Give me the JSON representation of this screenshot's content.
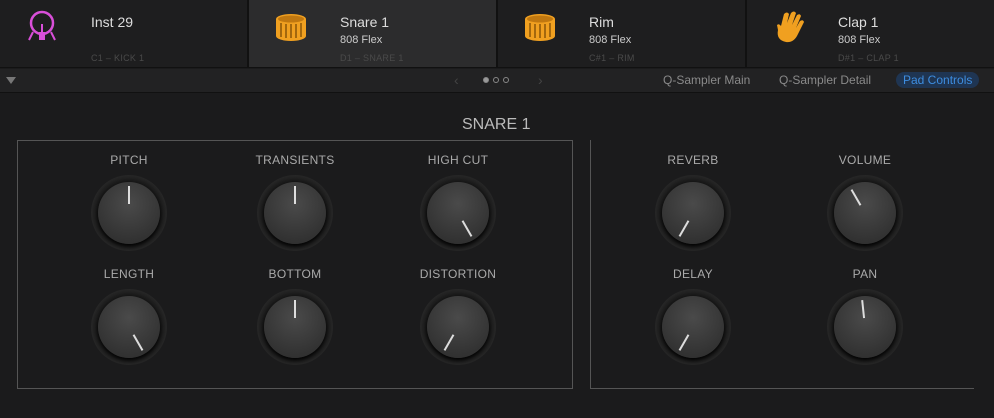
{
  "pads": [
    {
      "name": "Inst 29",
      "sub": "",
      "note": "C1 – KICK 1",
      "icon": "kick-drum-icon",
      "color": "#d94fd9"
    },
    {
      "name": "Snare 1",
      "sub": "808 Flex",
      "note": "D1 – SNARE 1",
      "icon": "snare-drum-icon",
      "color": "#f0a020"
    },
    {
      "name": "Rim",
      "sub": "808 Flex",
      "note": "C#1 – RIM",
      "icon": "snare-drum-icon",
      "color": "#f0a020"
    },
    {
      "name": "Clap 1",
      "sub": "808 Flex",
      "note": "D#1 – CLAP 1",
      "icon": "hand-clap-icon",
      "color": "#f0a020"
    }
  ],
  "nav": {
    "prev": "‹",
    "next": "›",
    "page": 1,
    "pages": 3
  },
  "tabs": [
    "Q-Sampler Main",
    "Q-Sampler Detail",
    "Pad Controls"
  ],
  "active_tab": "Pad Controls",
  "section_title": "SNARE 1",
  "knobs": [
    {
      "label": "PITCH",
      "value": 0.5
    },
    {
      "label": "TRANSIENTS",
      "value": 0.5
    },
    {
      "label": "HIGH CUT",
      "value": 1.0
    },
    {
      "label": "LENGTH",
      "value": 1.0
    },
    {
      "label": "BOTTOM",
      "value": 0.5
    },
    {
      "label": "DISTORTION",
      "value": 0.0
    },
    {
      "label": "REVERB",
      "value": 0.0
    },
    {
      "label": "VOLUME",
      "value": 0.4
    },
    {
      "label": "DELAY",
      "value": 0.0
    },
    {
      "label": "PAN",
      "value": 0.48
    }
  ]
}
